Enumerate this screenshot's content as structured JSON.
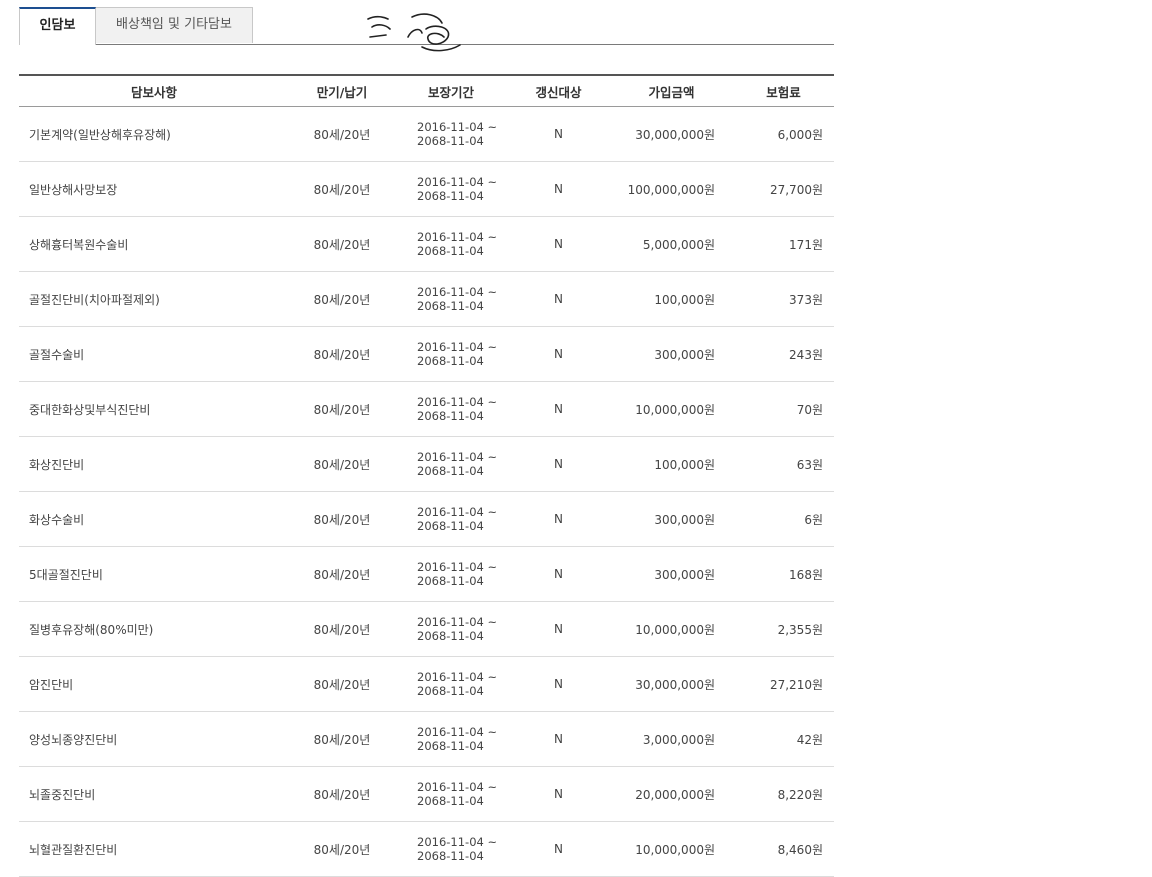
{
  "tabs": [
    {
      "label": "인담보",
      "active": true
    },
    {
      "label": "배상책임 및 기타담보",
      "active": false
    }
  ],
  "table": {
    "headers": [
      "담보사항",
      "만기/납기",
      "보장기간",
      "갱신대상",
      "가입금액",
      "보험료"
    ],
    "rows": [
      {
        "name": "기본계약(일반상해후유장해)",
        "term": "80세/20년",
        "period_start": "2016-11-04 ~",
        "period_end": "2068-11-04",
        "renew": "N",
        "amount": "30,000,000원",
        "premium": "6,000원"
      },
      {
        "name": "일반상해사망보장",
        "term": "80세/20년",
        "period_start": "2016-11-04 ~",
        "period_end": "2068-11-04",
        "renew": "N",
        "amount": "100,000,000원",
        "premium": "27,700원"
      },
      {
        "name": "상해흉터복원수술비",
        "term": "80세/20년",
        "period_start": "2016-11-04 ~",
        "period_end": "2068-11-04",
        "renew": "N",
        "amount": "5,000,000원",
        "premium": "171원"
      },
      {
        "name": "골절진단비(치아파절제외)",
        "term": "80세/20년",
        "period_start": "2016-11-04 ~",
        "period_end": "2068-11-04",
        "renew": "N",
        "amount": "100,000원",
        "premium": "373원"
      },
      {
        "name": "골절수술비",
        "term": "80세/20년",
        "period_start": "2016-11-04 ~",
        "period_end": "2068-11-04",
        "renew": "N",
        "amount": "300,000원",
        "premium": "243원"
      },
      {
        "name": "중대한화상및부식진단비",
        "term": "80세/20년",
        "period_start": "2016-11-04 ~",
        "period_end": "2068-11-04",
        "renew": "N",
        "amount": "10,000,000원",
        "premium": "70원"
      },
      {
        "name": "화상진단비",
        "term": "80세/20년",
        "period_start": "2016-11-04 ~",
        "period_end": "2068-11-04",
        "renew": "N",
        "amount": "100,000원",
        "premium": "63원"
      },
      {
        "name": "화상수술비",
        "term": "80세/20년",
        "period_start": "2016-11-04 ~",
        "period_end": "2068-11-04",
        "renew": "N",
        "amount": "300,000원",
        "premium": "6원"
      },
      {
        "name": "5대골절진단비",
        "term": "80세/20년",
        "period_start": "2016-11-04 ~",
        "period_end": "2068-11-04",
        "renew": "N",
        "amount": "300,000원",
        "premium": "168원"
      },
      {
        "name": "질병후유장해(80%미만)",
        "term": "80세/20년",
        "period_start": "2016-11-04 ~",
        "period_end": "2068-11-04",
        "renew": "N",
        "amount": "10,000,000원",
        "premium": "2,355원"
      },
      {
        "name": "암진단비",
        "term": "80세/20년",
        "period_start": "2016-11-04 ~",
        "period_end": "2068-11-04",
        "renew": "N",
        "amount": "30,000,000원",
        "premium": "27,210원"
      },
      {
        "name": "양성뇌종양진단비",
        "term": "80세/20년",
        "period_start": "2016-11-04 ~",
        "period_end": "2068-11-04",
        "renew": "N",
        "amount": "3,000,000원",
        "premium": "42원"
      },
      {
        "name": "뇌졸중진단비",
        "term": "80세/20년",
        "period_start": "2016-11-04 ~",
        "period_end": "2068-11-04",
        "renew": "N",
        "amount": "20,000,000원",
        "premium": "8,220원"
      },
      {
        "name": "뇌혈관질환진단비",
        "term": "80세/20년",
        "period_start": "2016-11-04 ~",
        "period_end": "2068-11-04",
        "renew": "N",
        "amount": "10,000,000원",
        "premium": "8,460원"
      }
    ]
  },
  "colors": {
    "tab_active_border": "#1d4f91",
    "tab_inactive_bg": "#f1f1f1",
    "row_divider": "#dcdcdc"
  },
  "icons": {
    "signature": "handwritten-scribble"
  }
}
